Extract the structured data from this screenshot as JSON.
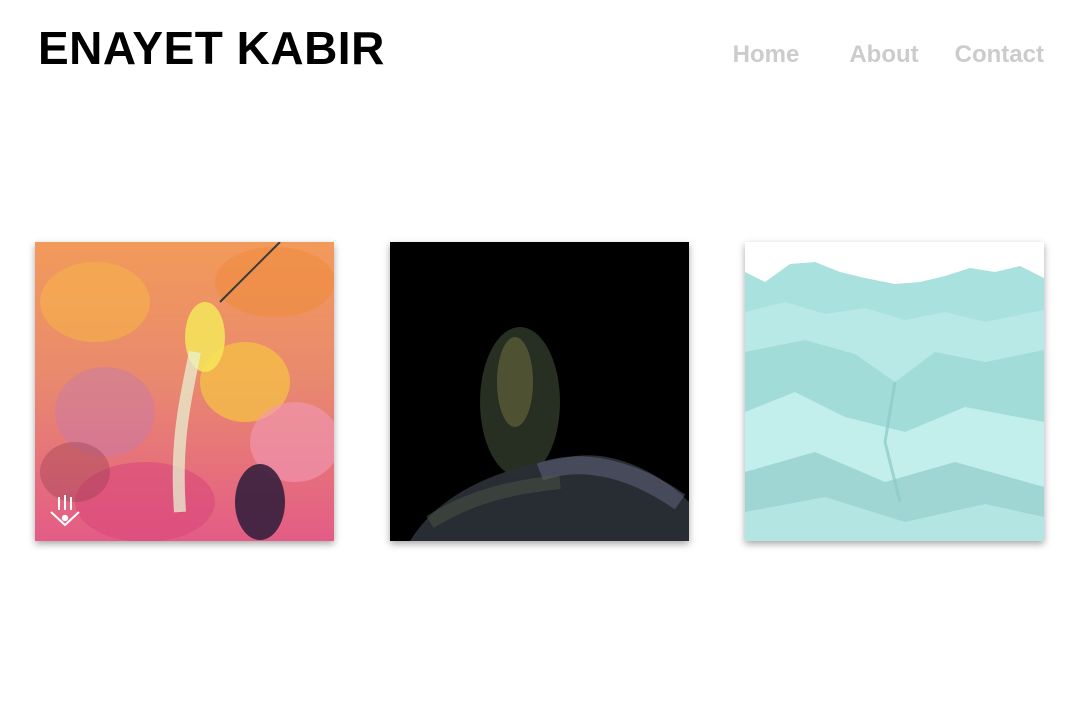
{
  "header": {
    "site_title": "ENAYET KABIR"
  },
  "nav": {
    "items": [
      {
        "label": "Home"
      },
      {
        "label": "About"
      },
      {
        "label": "Contact"
      }
    ]
  },
  "gallery": {
    "artworks": [
      {
        "icon": "watermark-hand-eye-icon",
        "palette": [
          "#f08a5d",
          "#e6587a",
          "#f5b942",
          "#c97fb0"
        ]
      },
      {
        "palette": [
          "#000000",
          "#3a4a3a",
          "#6b6f8a"
        ]
      },
      {
        "palette": [
          "#ffffff",
          "#a8e0de",
          "#7fc9c6",
          "#c6efec"
        ]
      }
    ]
  },
  "colors": {
    "title": "#000000",
    "nav_text": "#cccccc",
    "background": "#ffffff"
  }
}
